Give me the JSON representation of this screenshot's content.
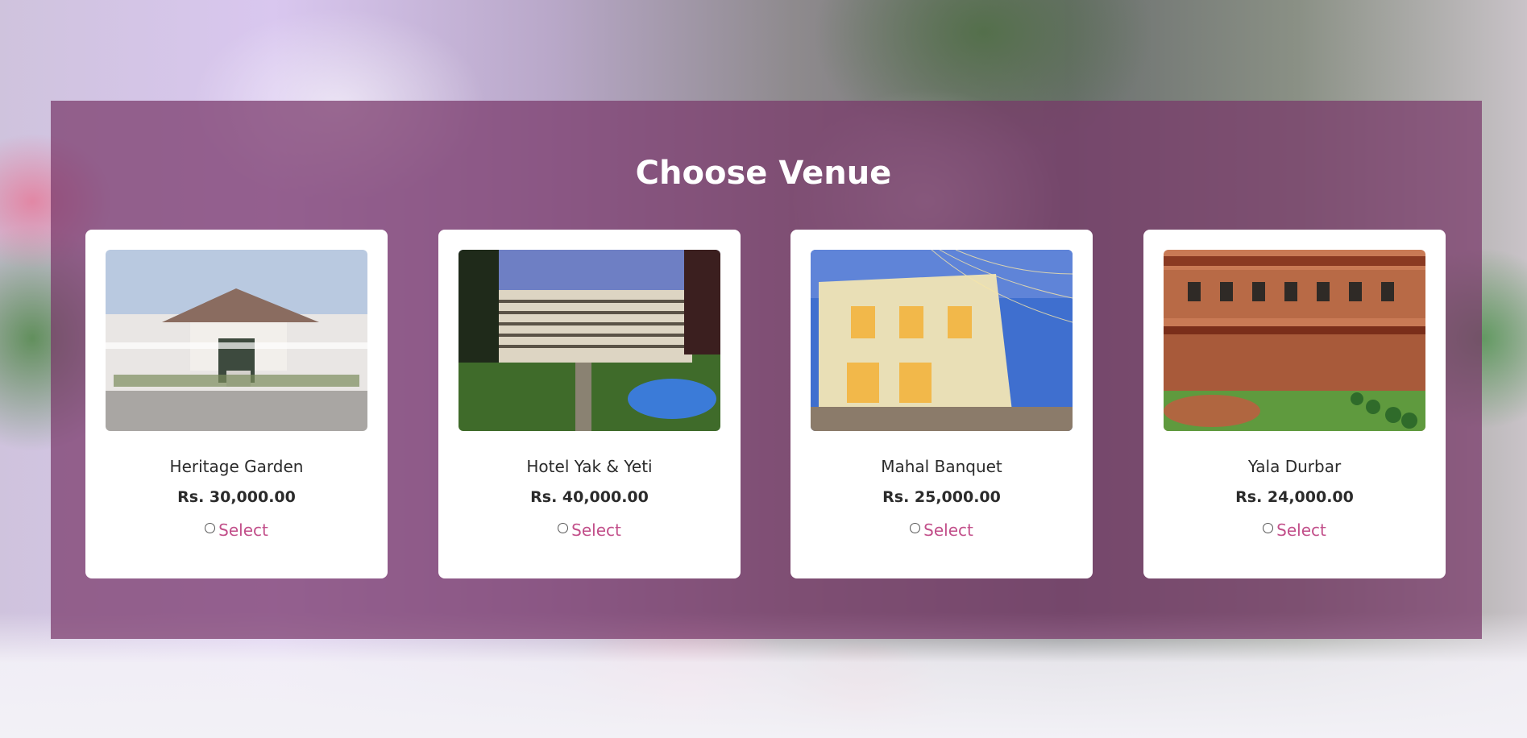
{
  "page": {
    "title": "Choose Venue"
  },
  "colors": {
    "panel": "#78376980",
    "accent": "#c24f8a",
    "card": "#ffffff"
  },
  "venues": [
    {
      "name": "Heritage Garden",
      "price": "Rs. 30,000.00",
      "select_label": "Select",
      "selected": false,
      "image": "heritage-garden-photo"
    },
    {
      "name": "Hotel Yak & Yeti",
      "price": "Rs. 40,000.00",
      "select_label": "Select",
      "selected": false,
      "image": "hotel-yak-yeti-photo"
    },
    {
      "name": "Mahal Banquet",
      "price": "Rs. 25,000.00",
      "select_label": "Select",
      "selected": false,
      "image": "mahal-banquet-photo"
    },
    {
      "name": "Yala Durbar",
      "price": "Rs. 24,000.00",
      "select_label": "Select",
      "selected": false,
      "image": "yala-durbar-photo"
    }
  ]
}
